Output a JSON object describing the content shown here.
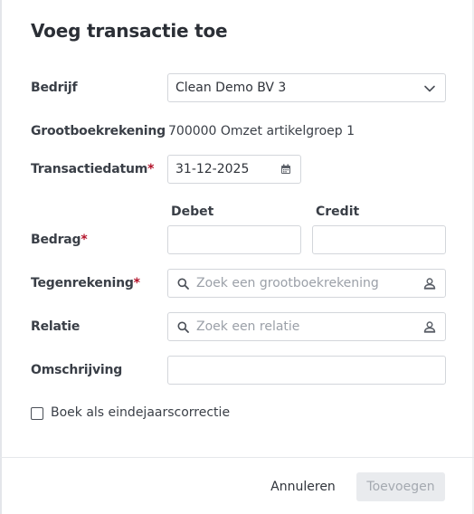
{
  "dialog": {
    "title": "Voeg transactie toe"
  },
  "fields": {
    "bedrijf": {
      "label": "Bedrijf",
      "value": "Clean Demo BV 3"
    },
    "grootboekrekening": {
      "label": "Grootboekrekening",
      "value": "700000 Omzet artikelgroep 1"
    },
    "transactiedatum": {
      "label": "Transactiedatum",
      "required_mark": "*",
      "value": "31-12-2025"
    },
    "bedrag": {
      "label": "Bedrag",
      "required_mark": "*",
      "debet_header": "Debet",
      "credit_header": "Credit",
      "debet_value": "",
      "credit_value": ""
    },
    "tegenrekening": {
      "label": "Tegenrekening",
      "required_mark": "*",
      "placeholder": "Zoek een grootboekrekening",
      "icon": "search-icon"
    },
    "relatie": {
      "label": "Relatie",
      "placeholder": "Zoek een relatie",
      "icon": "search-icon"
    },
    "omschrijving": {
      "label": "Omschrijving",
      "value": ""
    }
  },
  "checkbox": {
    "label": "Boek als eindejaarscorrectie",
    "checked": false
  },
  "footer": {
    "cancel_label": "Annuleren",
    "submit_label": "Toevoegen"
  },
  "colors": {
    "required": "#b3132a",
    "border": "#d3d6db",
    "disabled_button_bg": "#e9ebee",
    "disabled_button_text": "#a4a9b0"
  }
}
